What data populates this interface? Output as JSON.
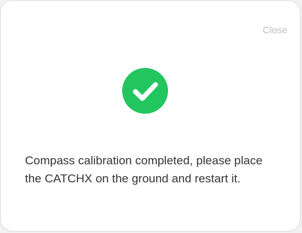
{
  "dialog": {
    "close_label": "Close",
    "message": "Compass calibration completed, please place the CATCHX on the ground and restart it.",
    "icon": "check-circle-icon"
  },
  "colors": {
    "success": "#22c55e",
    "close_text": "#bdbdbd",
    "message_text": "#333333"
  }
}
